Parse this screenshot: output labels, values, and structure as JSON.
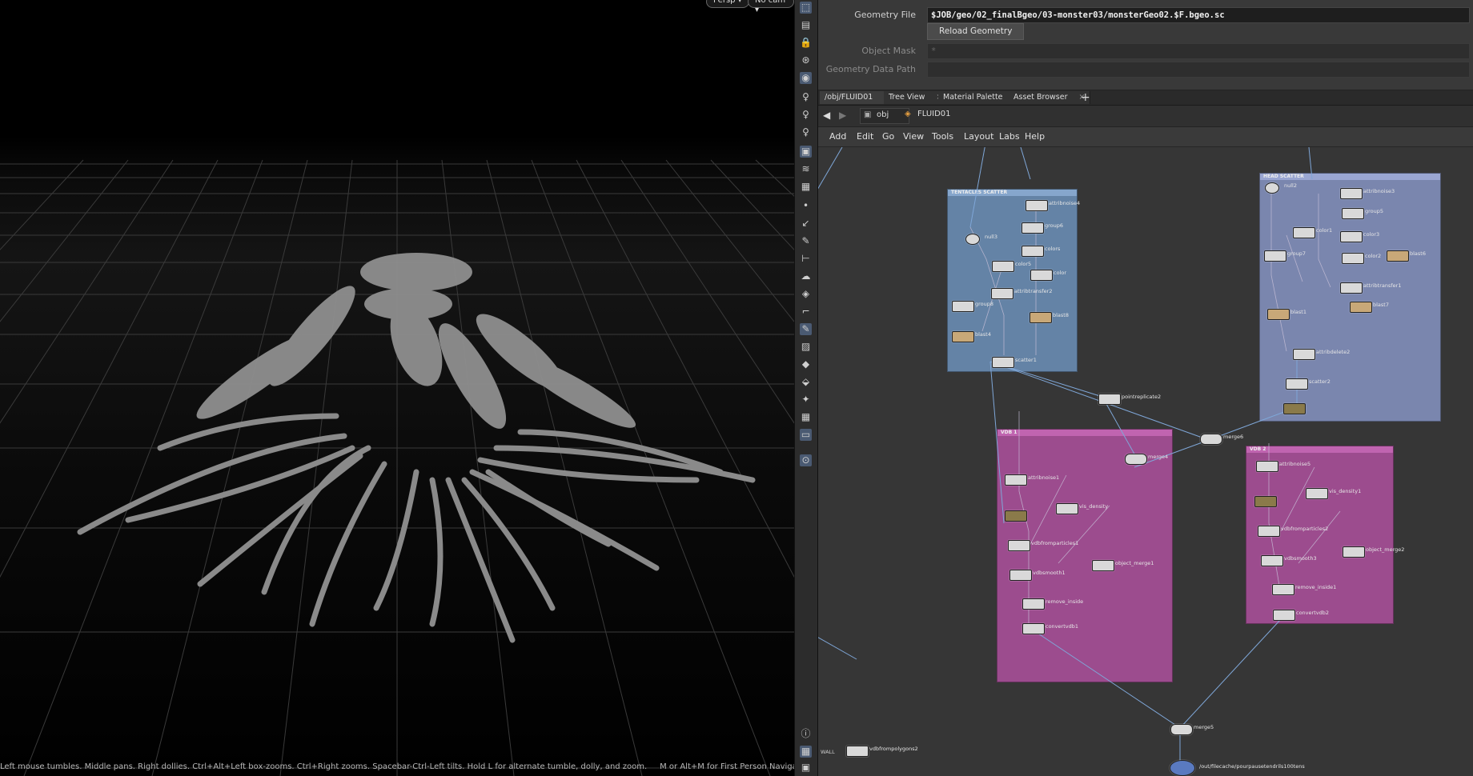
{
  "viewport": {
    "persp_label": "Persp ▾",
    "cam_label": "No cam ▾",
    "status": "Left mouse tumbles. Middle pans. Right dollies. Ctrl+Alt+Left box-zooms. Ctrl+Right zooms. Spacebar-Ctrl-Left tilts. Hold L for alternate tumble, dolly, and zoom.     M or Alt+M for First Person Navigation."
  },
  "params": {
    "geometry_file_label": "Geometry File",
    "geometry_file_value": "$JOB/geo/02_finalBgeo/03-monster03/monsterGeo02.$F.bgeo.sc",
    "reload_label": "Reload Geometry",
    "object_mask_label": "Object Mask",
    "object_mask_value": "*",
    "data_path_label": "Geometry Data Path"
  },
  "tabs": [
    {
      "label": "/obj/FLUID01"
    },
    {
      "label": "Tree View"
    },
    {
      "label": "Material Palette"
    },
    {
      "label": "Asset Browser"
    }
  ],
  "add_tab": "+",
  "path": {
    "obj": "obj",
    "node": "FLUID01"
  },
  "menus": [
    "Add",
    "Edit",
    "Go",
    "View",
    "Tools",
    "Layout",
    "Labs",
    "Help"
  ],
  "network": {
    "boxes": {
      "tentacles": "TENTACLES SCATTER",
      "head": "HEAD SCATTER",
      "vdb1": "VDB 1",
      "vdb2": "VDB 2"
    },
    "nodes": {
      "attribnoise4": "attribnoise4",
      "group6": "group6",
      "colors": "colors",
      "null3": "null3",
      "color5": "color5",
      "color": "color",
      "attribtransfer2": "attribtransfer2",
      "group8": "group8",
      "blast8": "blast8",
      "blast4": "blast4",
      "scatter1": "scatter1",
      "pointreplicate2": "pointreplicate2",
      "merge6": "merge6",
      "null2": "null2",
      "attribnoise3": "attribnoise3",
      "group5": "group5",
      "color1": "color1",
      "color3": "color3",
      "group7": "group7",
      "color2": "color2",
      "blast6": "blast6",
      "attribtransfer1": "attribtransfer1",
      "blast7": "blast7",
      "blast1": "blast1",
      "attribdelete2": "attribdelete2",
      "scatter2": "scatter2",
      "merge4": "merge4",
      "attribnoise1": "attribnoise1",
      "vis_density": "vis_density",
      "vdbfromparticles1": "vdbfromparticles1",
      "vdbsmooth1": "vdbsmooth1",
      "object_merge1": "object_merge1",
      "remove_inside": "remove_inside",
      "convertvdb1": "convertvdb1",
      "attribnoise5": "attribnoise5",
      "vis_density1": "vis_density1",
      "vdbfromparticles2": "vdbfromparticles2",
      "vdbsmooth3": "vdbsmooth3",
      "object_merge2": "object_merge2",
      "remove_inside1": "remove_inside1",
      "convertvdb2": "convertvdb2",
      "merge5": "merge5",
      "vdbfrompolygons2": "vdbfrompolygons2",
      "filecache": "/out/filecache/pourpausetendrils100tens",
      "wall": "WALL"
    }
  }
}
